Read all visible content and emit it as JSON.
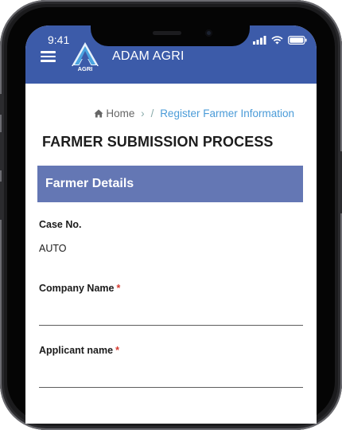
{
  "status_bar": {
    "time": "9:41"
  },
  "app_bar": {
    "brand_name": "ADAM AGRI",
    "logo_text": "AGRI",
    "colors": {
      "bar": "#3c5ba9"
    }
  },
  "breadcrumb": {
    "home_label": "Home",
    "separator": "/",
    "active_label": "Register Farmer Information"
  },
  "page": {
    "title": "FARMER SUBMISSION PROCESS"
  },
  "section": {
    "title": "Farmer Details",
    "colors": {
      "bar": "#6477b4"
    }
  },
  "form": {
    "case_no": {
      "label": "Case No.",
      "value": "AUTO"
    },
    "company_name": {
      "label": "Company Name",
      "required_mark": "*",
      "value": ""
    },
    "applicant_name": {
      "label": "Applicant name",
      "required_mark": "*",
      "value": ""
    }
  },
  "icons": [
    "menu-icon",
    "home-icon",
    "signal-icon",
    "wifi-icon",
    "battery-icon"
  ]
}
